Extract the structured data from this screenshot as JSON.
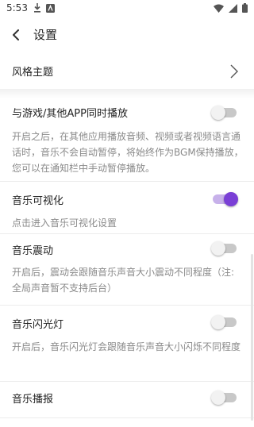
{
  "status_bar": {
    "time": "5:53"
  },
  "app_bar": {
    "title": "设置"
  },
  "theme_row": {
    "label": "风格主题"
  },
  "settings": {
    "game_play": {
      "title": "与游戏/其他APP同时播放",
      "desc": "开启之后，在其他应用播放音频、视频或者视频语言通话时，音乐不会自动暂停，将始终作为BGM保持播放，您可以在通知栏中手动暂停播放。",
      "enabled": false
    },
    "visualization": {
      "title": "音乐可视化",
      "desc": "点击进入音乐可视化设置",
      "enabled": true
    },
    "vibration": {
      "title": "音乐震动",
      "desc": "开启后，震动会跟随音乐声音大小震动不同程度（注:全局声音暂不支持后台）",
      "enabled": false
    },
    "flash": {
      "title": "音乐闪光灯",
      "desc": "开启后，音乐闪光灯会跟随音乐声音大小闪烁不同程度",
      "enabled": false
    },
    "broadcast": {
      "title": "音乐播报",
      "enabled": false
    }
  },
  "colors": {
    "accent": "#7a3fd6",
    "accent_track": "#c7b1ea"
  }
}
